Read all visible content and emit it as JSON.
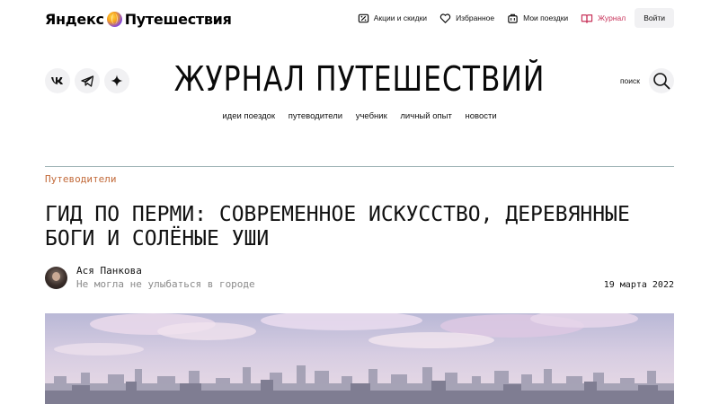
{
  "header": {
    "logo_text_left": "Яндекс",
    "logo_text_right": "Путешествия",
    "nav": [
      {
        "label": "Акции и скидки",
        "icon": "percent-ticket-icon"
      },
      {
        "label": "Избранное",
        "icon": "heart-icon"
      },
      {
        "label": "Мои поездки",
        "icon": "suitcase-icon"
      },
      {
        "label": "Журнал",
        "icon": "book-icon",
        "active": true
      }
    ],
    "login_label": "Войти"
  },
  "journal": {
    "title": "ЖУРНАЛ ПУТЕШЕСТВИЙ",
    "search_label": "поиск",
    "social": [
      "vk-icon",
      "telegram-icon",
      "sparkle-icon"
    ],
    "categories": [
      "идеи поездок",
      "путеводители",
      "учебник",
      "личный опыт",
      "новости"
    ]
  },
  "article": {
    "section": "Путеводители",
    "title_line1": "ГИД ПО ПЕРМИ: СОВРЕМЕННОЕ ИСКУССТВО, ДЕРЕВЯННЫЕ",
    "title_line2": "БОГИ И СОЛЁНЫЕ УШИ",
    "author": "Ася Панкова",
    "author_note": "Не могла не улыбаться в городе",
    "date": "19 марта 2022"
  },
  "colors": {
    "accent_active": "#c8345b",
    "section_label": "#c26a3a",
    "button_bg": "#f1f1f3"
  }
}
